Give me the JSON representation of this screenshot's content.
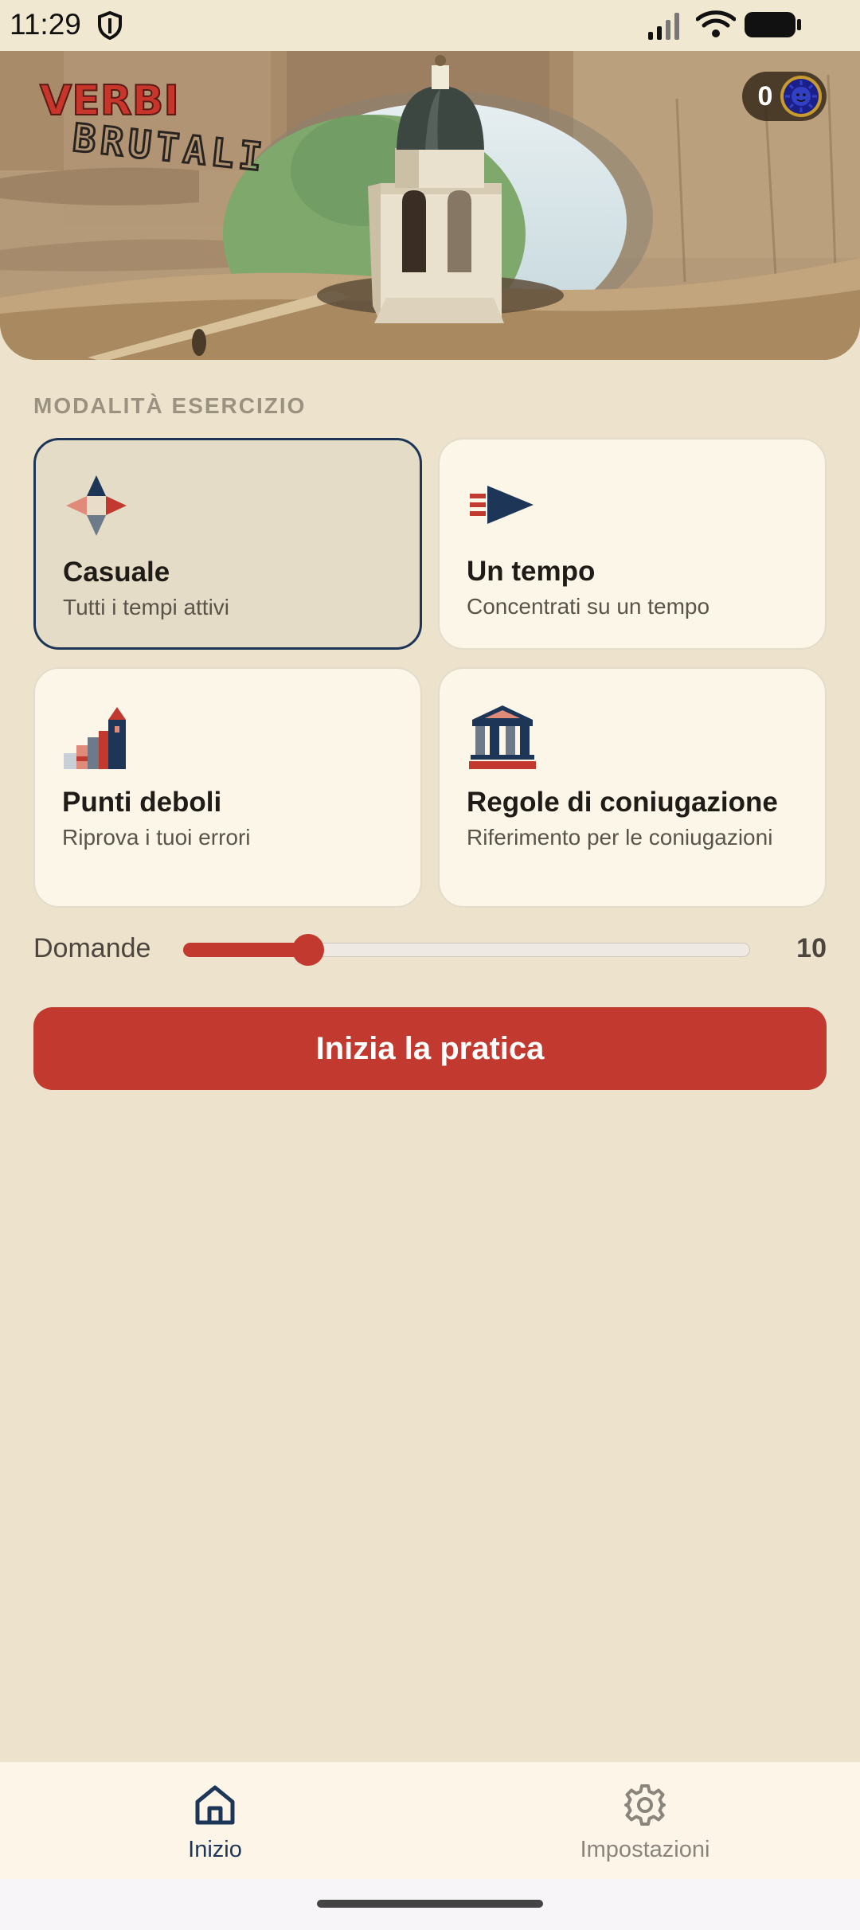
{
  "status_bar": {
    "time": "11:29",
    "icons": [
      "shield-icon",
      "signal-icon",
      "wifi-icon",
      "battery-icon"
    ]
  },
  "hero": {
    "logo_line1": "VERBI",
    "logo_line2": "BRUTALI",
    "coin_count": "0",
    "coin_icon": "sun-medallion-icon"
  },
  "practice": {
    "section_label": "MODALITÀ ESERCIZIO",
    "modes": [
      {
        "title": "Casuale",
        "subtitle": "Tutti i tempi attivi",
        "icon": "compass-icon",
        "selected": true
      },
      {
        "title": "Un tempo",
        "subtitle": "Concentrati su un tempo",
        "icon": "arrow-flag-icon",
        "selected": false
      },
      {
        "title": "Punti deboli",
        "subtitle": "Riprova i tuoi errori",
        "icon": "tower-steps-icon",
        "selected": false
      },
      {
        "title": "Regole di coniugazione",
        "subtitle": "Riferimento per le coniugazioni",
        "icon": "temple-icon",
        "selected": false
      }
    ]
  },
  "questions": {
    "label": "Domande",
    "value": "10",
    "slider_fraction": 0.22
  },
  "start_button": {
    "label": "Inizia la pratica"
  },
  "bottom_nav": {
    "items": [
      {
        "label": "Inizio",
        "icon": "home-icon",
        "active": true
      },
      {
        "label": "Impostazioni",
        "icon": "gear-icon",
        "active": false
      }
    ]
  },
  "colors": {
    "accent_red": "#c1392f",
    "navy": "#1d3557",
    "background": "#ede3cc",
    "card": "#fcf6e8"
  }
}
